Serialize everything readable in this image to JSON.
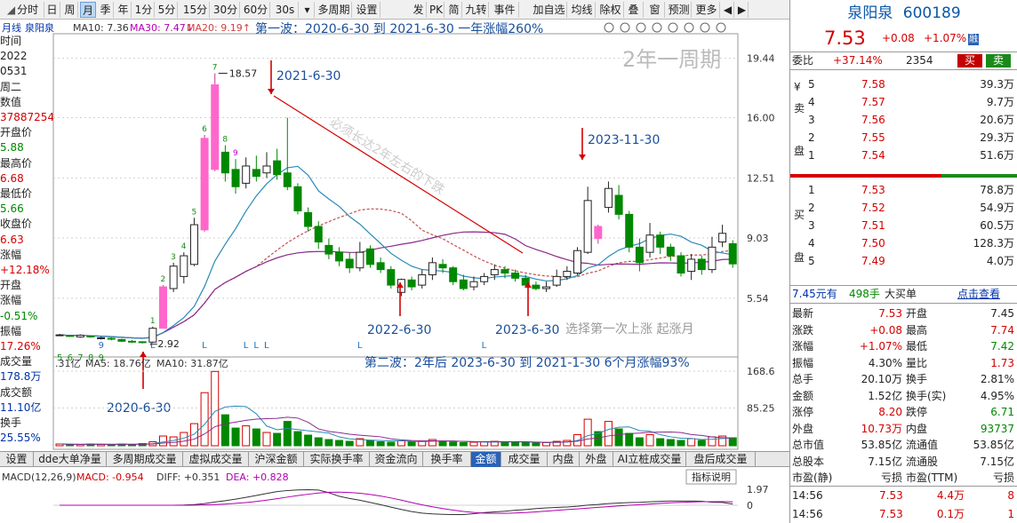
{
  "toolbar": {
    "buttons": [
      "分时",
      "日",
      "周",
      "月",
      "季",
      "年",
      "1分",
      "5分",
      "15分",
      "30分",
      "60分",
      "30s",
      "多周期",
      "设置"
    ],
    "active": "月",
    "dropdown": "▾",
    "right_buttons": [
      "发",
      "PK",
      "简",
      "九转",
      "事件",
      "加自选",
      "均线",
      "除权",
      "叠",
      "窗",
      "预测",
      "更多"
    ]
  },
  "chart_header": {
    "period": "月线",
    "stock": "泉阳泉",
    "ma10": "MA10: 7.36",
    "ma30": "MA30: 7.47",
    "ma20": "MA20: 9.19",
    "wave1": "第一波：2020-6-30 到 2021-6-30 一年涨幅260%",
    "watermark": "2年一周期"
  },
  "annotations": {
    "high_label": "18.57",
    "low_label": "2.92",
    "d2021": "2021-6-30",
    "d2023_11": "2023-11-30",
    "d2022": "2022-6-30",
    "d2023_6": "2023-6-30",
    "d2020": "2020-6-30",
    "select_text": "选择第一次上涨 起涨月",
    "diag_text": "必须长达2年左右的下跌",
    "wave2": "第二波：2年后 2023-6-30 到 2021-1-30 6个月涨幅93%"
  },
  "price_axis": [
    "19.44",
    "16.00",
    "12.51",
    "9.03",
    "5.54"
  ],
  "vol_axis": [
    "168.6",
    "85.25"
  ],
  "macd_axis": [
    "1.97",
    "0"
  ],
  "vol_header": {
    "a": ".31亿",
    "ma5": "MA5: 18.76亿",
    "ma10": "MA10: 31.87亿"
  },
  "macd_header": {
    "name": "MACD(12,26,9)",
    "macd": "MACD: -0.954",
    "diff": "DIFF: +0.351",
    "dea": "DEA: +0.828",
    "btn": "指标说明"
  },
  "left_panel": [
    {
      "t": "时间",
      "cls": ""
    },
    {
      "t": "2022",
      "cls": ""
    },
    {
      "t": "0531",
      "cls": ""
    },
    {
      "t": "周二",
      "cls": ""
    },
    {
      "t": "数值",
      "cls": ""
    },
    {
      "t": "37887254",
      "cls": "red"
    },
    {
      "t": "开盘价",
      "cls": ""
    },
    {
      "t": "5.88",
      "cls": "green"
    },
    {
      "t": "最高价",
      "cls": ""
    },
    {
      "t": "6.68",
      "cls": "red"
    },
    {
      "t": "最低价",
      "cls": ""
    },
    {
      "t": "5.66",
      "cls": "green"
    },
    {
      "t": "收盘价",
      "cls": ""
    },
    {
      "t": "6.63",
      "cls": "red"
    },
    {
      "t": "涨幅",
      "cls": ""
    },
    {
      "t": "+12.18%",
      "cls": "red"
    },
    {
      "t": "开盘",
      "cls": ""
    },
    {
      "t": "涨幅",
      "cls": ""
    },
    {
      "t": "-0.51%",
      "cls": "green"
    },
    {
      "t": "振幅",
      "cls": ""
    },
    {
      "t": "17.26%",
      "cls": "red"
    },
    {
      "t": "成交量",
      "cls": ""
    },
    {
      "t": "178.8万",
      "cls": "blue"
    },
    {
      "t": "成交额",
      "cls": ""
    },
    {
      "t": "11.10亿",
      "cls": "blue"
    },
    {
      "t": "换手",
      "cls": ""
    },
    {
      "t": "25.55%",
      "cls": "blue"
    }
  ],
  "bottom_tabs": [
    "设置",
    "dde大单净量",
    "多周期成交量",
    "虚拟成交量",
    "沪深金额",
    "实际换手率",
    "资金流向",
    "换手率",
    "金额",
    "成交量",
    "内盘",
    "外盘",
    "AI立桩成交量",
    "盘后成交量"
  ],
  "bottom_active": "金额",
  "quote": {
    "name": "泉阳泉",
    "code": "600189",
    "price": "7.53",
    "change": "+0.08",
    "pct": "+1.07%",
    "badge": "融",
    "weibi_label": "委比",
    "weibi": "+37.14%",
    "weicha": "2354",
    "buy_btn": "买",
    "sell_btn": "卖",
    "sell_side": "卖盘",
    "buy_side": "买盘",
    "asks": [
      {
        "lvl": "5",
        "p": "7.58",
        "v": "39.3万"
      },
      {
        "lvl": "4",
        "p": "7.57",
        "v": "9.7万"
      },
      {
        "lvl": "3",
        "p": "7.56",
        "v": "20.6万"
      },
      {
        "lvl": "2",
        "p": "7.55",
        "v": "29.3万"
      },
      {
        "lvl": "1",
        "p": "7.54",
        "v": "51.6万"
      }
    ],
    "bids": [
      {
        "lvl": "1",
        "p": "7.53",
        "v": "78.8万"
      },
      {
        "lvl": "2",
        "p": "7.52",
        "v": "54.9万"
      },
      {
        "lvl": "3",
        "p": "7.51",
        "v": "60.5万"
      },
      {
        "lvl": "4",
        "p": "7.50",
        "v": "128.3万"
      },
      {
        "lvl": "5",
        "p": "7.49",
        "v": "4.0万"
      }
    ],
    "bigorder": {
      "a": "7.45元有",
      "b": "498手",
      "c": "大买单",
      "link": "点击查看"
    },
    "stats": [
      {
        "l1": "最新",
        "v1": "7.53",
        "c1": "red",
        "l2": "开盘",
        "v2": "7.45",
        "c2": ""
      },
      {
        "l1": "涨跌",
        "v1": "+0.08",
        "c1": "red",
        "l2": "最高",
        "v2": "7.74",
        "c2": "red"
      },
      {
        "l1": "涨幅",
        "v1": "+1.07%",
        "c1": "red",
        "l2": "最低",
        "v2": "7.42",
        "c2": "green"
      },
      {
        "l1": "振幅",
        "v1": "4.30%",
        "c1": "",
        "l2": "量比",
        "v2": "1.73",
        "c2": "red"
      },
      {
        "l1": "总手",
        "v1": "20.10万",
        "c1": "",
        "l2": "换手",
        "v2": "2.81%",
        "c2": ""
      },
      {
        "l1": "金额",
        "v1": "1.52亿",
        "c1": "",
        "l2": "换手(实)",
        "v2": "4.95%",
        "c2": ""
      },
      {
        "l1": "涨停",
        "v1": "8.20",
        "c1": "red",
        "l2": "跌停",
        "v2": "6.71",
        "c2": "green"
      },
      {
        "l1": "外盘",
        "v1": "10.73万",
        "c1": "red",
        "l2": "内盘",
        "v2": "93737",
        "c2": "green"
      },
      {
        "l1": "总市值",
        "v1": "53.85亿",
        "c1": "",
        "l2": "流通值",
        "v2": "53.85亿",
        "c2": ""
      },
      {
        "l1": "总股本",
        "v1": "7.15亿",
        "c1": "",
        "l2": "流通股",
        "v2": "7.15亿",
        "c2": ""
      },
      {
        "l1": "市盈(静)",
        "v1": "亏损",
        "c1": "",
        "l2": "市盈(TTM)",
        "v2": "亏损",
        "c2": ""
      }
    ],
    "ticks": [
      {
        "t": "14:56",
        "p": "7.53",
        "v": "4.4万",
        "n": "8"
      },
      {
        "t": "14:56",
        "p": "7.53",
        "v": "0.1万",
        "n": "1"
      }
    ]
  },
  "colors": {
    "up": "#d40000",
    "down": "#008800",
    "limit": "#ff66cc",
    "accent": "#1a6fb5"
  },
  "chart_data": {
    "type": "candlestick",
    "candles": [
      [
        3.4,
        3.42,
        3.48,
        3.38
      ],
      [
        3.38,
        3.35,
        3.42,
        3.3
      ],
      [
        3.3,
        3.4,
        3.45,
        3.25
      ],
      [
        3.35,
        3.3,
        3.38,
        3.25
      ],
      [
        3.2,
        3.25,
        3.3,
        3.15
      ],
      [
        3.22,
        3.18,
        3.28,
        3.1
      ],
      [
        3.15,
        3.05,
        3.2,
        3.0
      ],
      [
        3.05,
        3.02,
        3.12,
        2.95
      ],
      [
        3.02,
        3.0,
        3.05,
        2.92
      ],
      [
        3.0,
        3.8,
        3.9,
        2.95
      ],
      [
        3.8,
        6.2,
        6.3,
        3.8
      ],
      [
        6.1,
        7.4,
        7.6,
        5.9
      ],
      [
        6.8,
        8.0,
        8.2,
        6.4
      ],
      [
        7.5,
        9.8,
        10.2,
        7.4
      ],
      [
        9.5,
        14.8,
        15.0,
        9.4
      ],
      [
        13.0,
        17.9,
        18.57,
        12.9
      ],
      [
        14.0,
        12.8,
        14.4,
        12.3
      ],
      [
        13.0,
        12.0,
        13.6,
        11.6
      ],
      [
        12.2,
        13.2,
        13.7,
        11.9
      ],
      [
        13.0,
        12.6,
        13.8,
        12.3
      ],
      [
        12.8,
        13.2,
        14.0,
        12.5
      ],
      [
        13.5,
        12.7,
        14.2,
        12.4
      ],
      [
        12.8,
        12.0,
        16.0,
        11.8
      ],
      [
        12.0,
        10.6,
        12.2,
        10.4
      ],
      [
        10.5,
        9.7,
        10.8,
        9.4
      ],
      [
        9.7,
        8.8,
        10.0,
        8.4
      ],
      [
        8.6,
        8.1,
        9.0,
        7.8
      ],
      [
        8.2,
        7.7,
        8.5,
        7.4
      ],
      [
        7.8,
        7.3,
        8.2,
        7.0
      ],
      [
        7.3,
        8.2,
        8.8,
        7.1
      ],
      [
        8.4,
        7.5,
        8.6,
        7.3
      ],
      [
        7.6,
        7.2,
        7.9,
        7.0
      ],
      [
        7.2,
        6.3,
        7.4,
        6.1
      ],
      [
        5.88,
        6.63,
        6.68,
        5.66
      ],
      [
        6.6,
        6.2,
        6.8,
        6.0
      ],
      [
        6.3,
        6.9,
        7.2,
        6.1
      ],
      [
        6.9,
        7.6,
        7.9,
        6.6
      ],
      [
        7.5,
        7.3,
        7.8,
        7.0
      ],
      [
        7.3,
        6.5,
        7.4,
        6.3
      ],
      [
        6.6,
        6.1,
        6.9,
        6.0
      ],
      [
        6.2,
        6.5,
        6.8,
        6.0
      ],
      [
        6.5,
        6.8,
        7.0,
        6.3
      ],
      [
        6.9,
        7.2,
        7.5,
        6.6
      ],
      [
        7.2,
        7.0,
        7.4,
        6.7
      ],
      [
        7.0,
        6.7,
        7.2,
        6.5
      ],
      [
        6.7,
        6.3,
        6.9,
        6.2
      ],
      [
        6.3,
        6.1,
        6.5,
        6.0
      ],
      [
        6.1,
        6.2,
        6.5,
        5.9
      ],
      [
        6.3,
        6.8,
        7.2,
        6.2
      ],
      [
        6.8,
        7.1,
        7.4,
        6.6
      ],
      [
        7.0,
        8.3,
        8.5,
        6.9
      ],
      [
        8.2,
        11.2,
        12.0,
        8.1
      ],
      [
        9.7,
        9.0,
        9.8,
        8.7
      ],
      [
        10.8,
        11.9,
        12.3,
        10.5
      ],
      [
        11.5,
        10.4,
        12.1,
        10.1
      ],
      [
        10.4,
        8.5,
        10.6,
        8.2
      ],
      [
        8.5,
        7.6,
        9.0,
        7.1
      ],
      [
        8.2,
        9.2,
        9.9,
        7.9
      ],
      [
        9.2,
        8.5,
        9.4,
        8.1
      ],
      [
        8.5,
        8.0,
        8.7,
        7.7
      ],
      [
        8.0,
        7.0,
        8.2,
        6.8
      ],
      [
        7.1,
        7.8,
        8.1,
        6.6
      ],
      [
        7.8,
        7.2,
        8.0,
        6.9
      ],
      [
        7.2,
        8.5,
        9.1,
        7.0
      ],
      [
        8.8,
        9.3,
        9.8,
        8.5
      ],
      [
        8.7,
        7.53,
        8.9,
        7.3
      ]
    ],
    "limit_up_indices": [
      10,
      14,
      15,
      52
    ],
    "volume_yi": [
      4,
      3,
      3,
      4,
      3,
      3,
      4,
      3,
      5,
      9,
      22,
      20,
      30,
      50,
      120,
      168,
      70,
      40,
      45,
      38,
      30,
      28,
      55,
      32,
      24,
      18,
      14,
      12,
      10,
      16,
      12,
      9,
      8,
      11,
      9,
      10,
      14,
      10,
      8,
      7,
      8,
      9,
      10,
      9,
      8,
      7,
      6,
      7,
      10,
      12,
      25,
      60,
      32,
      55,
      38,
      28,
      18,
      25,
      16,
      14,
      12,
      16,
      12,
      20,
      22,
      18
    ],
    "ylim": [
      2.5,
      20.5
    ],
    "vol_max": 168.6
  }
}
